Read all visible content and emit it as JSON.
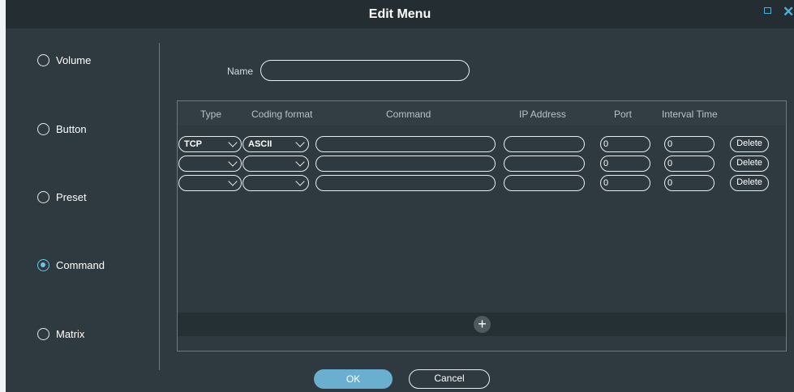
{
  "window": {
    "title": "Edit Menu",
    "maximize_icon": "maximize-icon",
    "close_icon": "close-icon",
    "close_glyph": "✕"
  },
  "sidebar": {
    "options": [
      {
        "label": "Volume",
        "checked": false
      },
      {
        "label": "Button",
        "checked": false
      },
      {
        "label": "Preset",
        "checked": false
      },
      {
        "label": "Command",
        "checked": true
      },
      {
        "label": "Matrix",
        "checked": false
      }
    ]
  },
  "form": {
    "name_label": "Name",
    "name_value": ""
  },
  "table": {
    "headers": [
      "Type",
      "Coding format",
      "Command",
      "IP Address",
      "Port",
      "Interval Time"
    ],
    "rows": [
      {
        "type": "TCP",
        "coding": "ASCII",
        "command": "",
        "ip": "",
        "port": "0",
        "interval": "0",
        "delete": "Delete"
      },
      {
        "type": "",
        "coding": "",
        "command": "",
        "ip": "",
        "port": "0",
        "interval": "0",
        "delete": "Delete"
      },
      {
        "type": "",
        "coding": "",
        "command": "",
        "ip": "",
        "port": "0",
        "interval": "0",
        "delete": "Delete"
      }
    ],
    "add_glyph": "+"
  },
  "footer": {
    "ok_label": "OK",
    "cancel_label": "Cancel"
  },
  "colors": {
    "background": "#2e3a40",
    "titlebar": "#232d32",
    "accent": "#6aaed0",
    "radio_checked": "#6fc4e3"
  }
}
